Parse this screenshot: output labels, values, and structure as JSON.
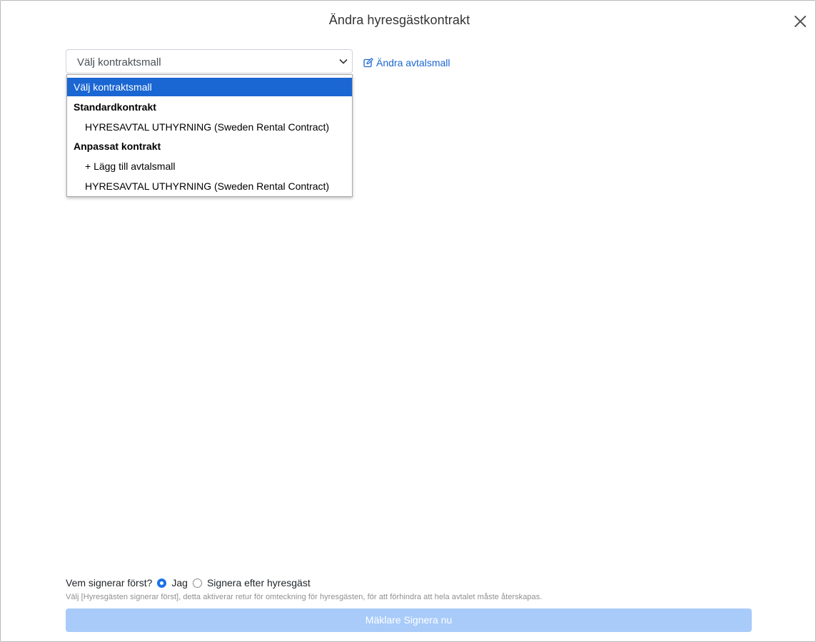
{
  "modal": {
    "title": "Ändra hyresgästkontrakt"
  },
  "template_select": {
    "value": "Välj kontraktsmall",
    "options": [
      {
        "label": "Välj kontraktsmall",
        "kind": "selected"
      },
      {
        "label": "Standardkontrakt",
        "kind": "group"
      },
      {
        "label": "HYRESAVTAL UTHYRNING (Sweden Rental Contract)",
        "kind": "option"
      },
      {
        "label": "Anpassat kontrakt",
        "kind": "group"
      },
      {
        "label": "+ Lägg till avtalsmall",
        "kind": "option"
      },
      {
        "label": "HYRESAVTAL UTHYRNING (Sweden Rental Contract)",
        "kind": "option"
      }
    ]
  },
  "edit_template_link": "Ändra avtalsmall",
  "signing": {
    "question": "Vem signerar först?",
    "option_me": "Jag",
    "option_after_tenant": "Signera efter hyresgäst",
    "selected": "Jag",
    "hint": "Välj [Hyresgästen signerar först], detta aktiverar retur för omteckning för hyresgästen, för att förhindra att hela avtalet måste återskapas."
  },
  "sign_button": "Mäklare Signera nu",
  "colors": {
    "accent": "#1a66d2",
    "button_disabled": "#a9cbfa"
  }
}
